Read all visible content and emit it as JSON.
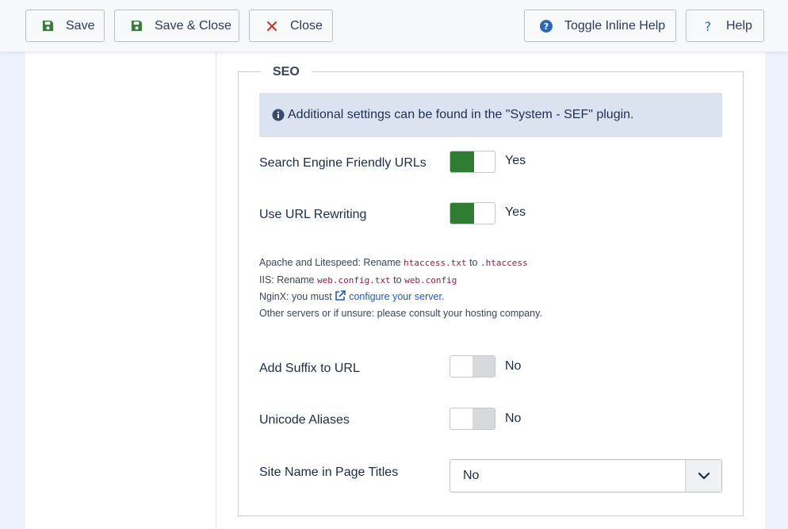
{
  "toolbar": {
    "save_label": "Save",
    "save_close_label": "Save & Close",
    "close_label": "Close",
    "toggle_help_label": "Toggle Inline Help",
    "help_label": "Help"
  },
  "seo": {
    "legend": "SEO",
    "alert_text": "Additional settings can be found in the \"System - SEF\" plugin.",
    "fields": [
      {
        "label": "Search Engine Friendly URLs",
        "value": "Yes"
      },
      {
        "label": "Use URL Rewriting",
        "value": "Yes"
      },
      {
        "label": "Add Suffix to URL",
        "value": "No"
      },
      {
        "label": "Unicode Aliases",
        "value": "No"
      }
    ],
    "note": {
      "apache_prefix": "Apache and Litespeed: Rename",
      "apache_from": "htaccess.txt",
      "to": "to",
      "apache_to": ".htaccess",
      "iis_prefix": "IIS: Rename",
      "iis_from": "web.config.txt",
      "iis_to": "web.config",
      "nginx_prefix": "NginX: you must",
      "nginx_link": "configure your server",
      "nginx_suffix": ".",
      "other": "Other servers or if unsure: please consult your hosting company."
    },
    "site_name": {
      "label": "Site Name in Page Titles",
      "selected": "No"
    }
  },
  "colors": {
    "switch_on": "#2e7d32",
    "switch_off": "#d7d9dc",
    "close_icon": "#c9302c",
    "save_icon": "#3b7a3f",
    "help_icon": "#2a69b8"
  }
}
